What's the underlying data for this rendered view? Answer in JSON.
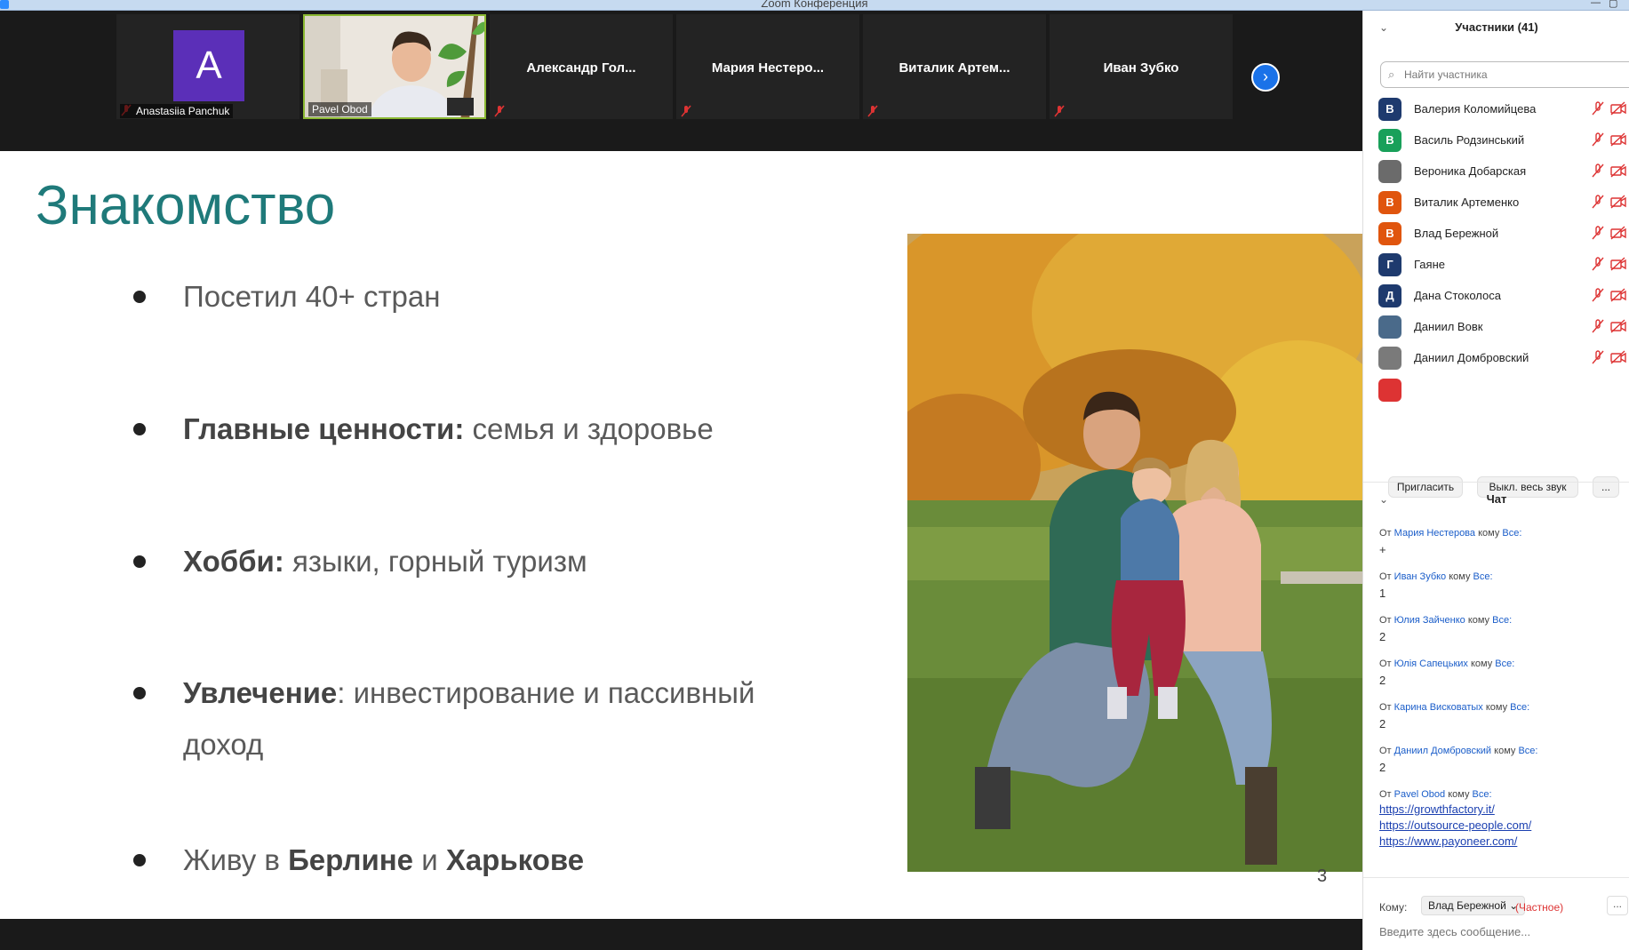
{
  "window": {
    "title": "Zoom Конференция"
  },
  "video_strip": {
    "tiles": [
      {
        "name": "Anastasiia Panchuk",
        "initial": "A"
      },
      {
        "name": "Pavel Obod"
      },
      {
        "name": "Александр  Гол..."
      },
      {
        "name": "Мария  Нестеро..."
      },
      {
        "name": "Виталик  Артем..."
      },
      {
        "name": "Иван Зубко"
      }
    ],
    "next_icon": "chevron-right-icon"
  },
  "slide": {
    "title": "Знакомство",
    "bullets": [
      {
        "plain": "Посетил 40+ стран"
      },
      {
        "bold": "Главные ценности:",
        "rest": " семья и здоровье"
      },
      {
        "bold": "Хобби:",
        "rest": " языки, горный туризм"
      },
      {
        "bold": "Увлечение",
        "rest": ": инвестирование и пассивный доход"
      },
      {
        "pre": "Живу в ",
        "bold1": "Берлине",
        "mid": " и ",
        "bold2": "Харькове"
      }
    ],
    "page_number": "3"
  },
  "participants": {
    "header": "Участники (41)",
    "search_placeholder": "Найти участника",
    "list": [
      {
        "name": "Валерия Коломийцева",
        "initial": "В",
        "color": "#1e3a6e"
      },
      {
        "name": "Василь Родзинський",
        "initial": "В",
        "color": "#19a05a"
      },
      {
        "name": "Вероника Добарская",
        "initial": "",
        "color": "#6b6b6b"
      },
      {
        "name": "Виталик Артеменко",
        "initial": "В",
        "color": "#e0550e"
      },
      {
        "name": "Влад Бережной",
        "initial": "В",
        "color": "#e0550e"
      },
      {
        "name": "Гаяне",
        "initial": "Г",
        "color": "#1e3a6e"
      },
      {
        "name": "Дана Стоколоса",
        "initial": "Д",
        "color": "#1e3a6e"
      },
      {
        "name": "Даниил Вовк",
        "initial": "",
        "color": "#4a6a8a"
      },
      {
        "name": "Даниил Домбровский",
        "initial": "",
        "color": "#7a7a7a"
      }
    ],
    "invite_button": "Пригласить",
    "mute_all_button": "Выкл. весь звук",
    "more_button": "..."
  },
  "chat": {
    "header": "Чат",
    "from_word": "От",
    "to_word": "кому",
    "everyone": "Все:",
    "messages": [
      {
        "sender": "Мария Нестерова",
        "text": "+"
      },
      {
        "sender": "Иван Зубко",
        "text": "1"
      },
      {
        "sender": "Юлия Зайченко",
        "text": "2"
      },
      {
        "sender": "Юлія Сапецьких",
        "text": "2"
      },
      {
        "sender": "Карина Висковатых",
        "text": "2"
      },
      {
        "sender": "Даниил Домбровский",
        "text": "2"
      },
      {
        "sender": "Pavel Obod",
        "links": [
          "https://growthfactory.it/",
          "https://outsource-people.com/",
          "https://www.payoneer.com/"
        ]
      }
    ],
    "to_label": "Кому:",
    "recipient": "Влад Бережной",
    "private_label": "(Частное)",
    "more": "...",
    "input_placeholder": "Введите здесь сообщение..."
  }
}
